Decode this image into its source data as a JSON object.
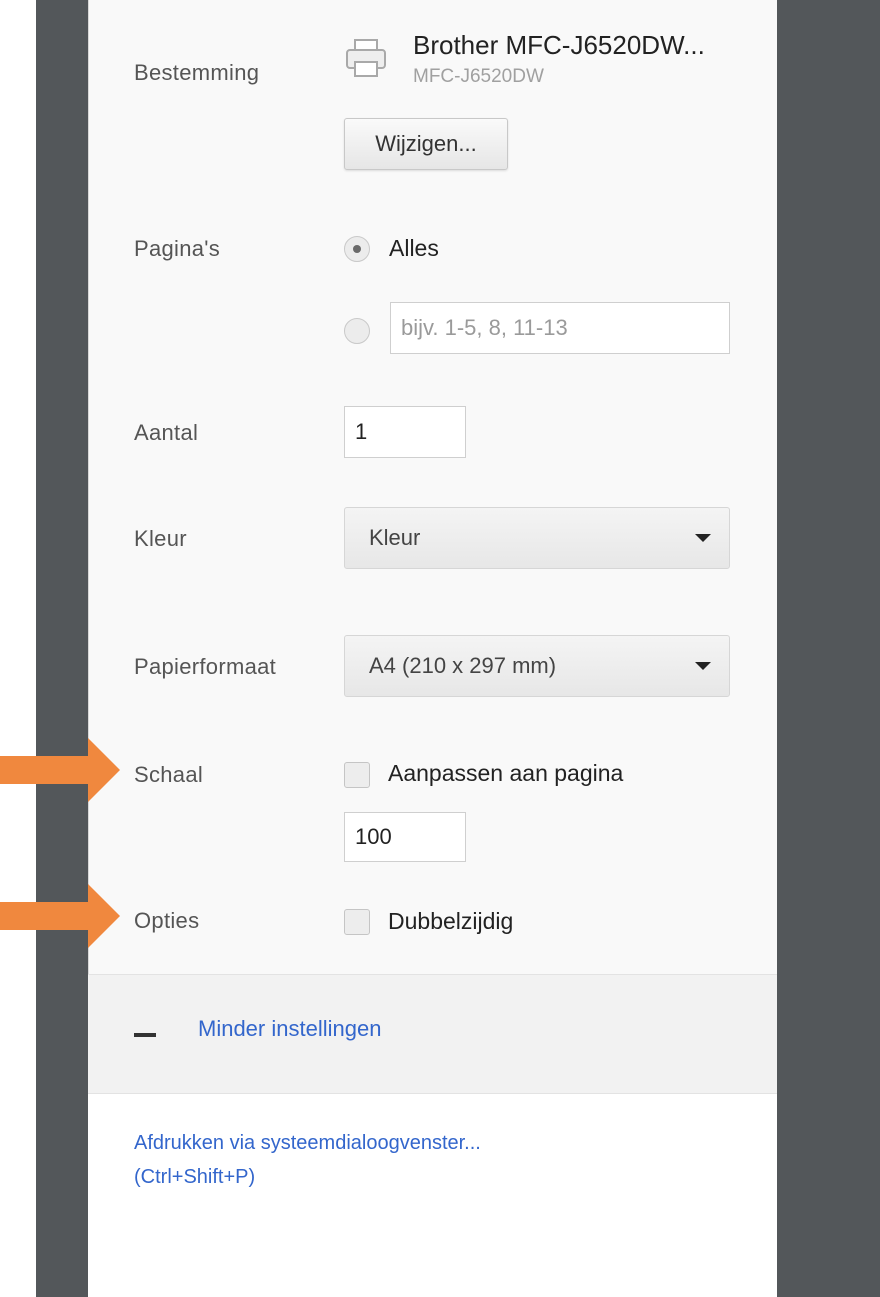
{
  "destination": {
    "label": "Bestemming",
    "printer_name": "Brother MFC-J6520DW...",
    "printer_model": "MFC-J6520DW",
    "change_button": "Wijzigen..."
  },
  "pages": {
    "label": "Pagina's",
    "all_option": "Alles",
    "range_placeholder": "bijv. 1-5, 8, 11-13",
    "selected": "Alles"
  },
  "copies": {
    "label": "Aantal",
    "value": "1"
  },
  "color": {
    "label": "Kleur",
    "selected": "Kleur"
  },
  "paper_size": {
    "label": "Papierformaat",
    "selected": "A4 (210 x 297 mm)"
  },
  "scale": {
    "label": "Schaal",
    "fit_to_page_label": "Aanpassen aan pagina",
    "fit_to_page_checked": false,
    "value": "100"
  },
  "options": {
    "label": "Opties",
    "duplex_label": "Dubbelzijdig",
    "duplex_checked": false
  },
  "less_settings": {
    "label": "Minder instellingen"
  },
  "system_dialog": {
    "label": "Afdrukken via systeemdialoogvenster...",
    "shortcut": "(Ctrl+Shift+P)"
  },
  "colors": {
    "panel_background": "#f9f9f9",
    "dark_sidebar": "#53575a",
    "link": "#3366cc",
    "arrow": "#f0883e"
  }
}
